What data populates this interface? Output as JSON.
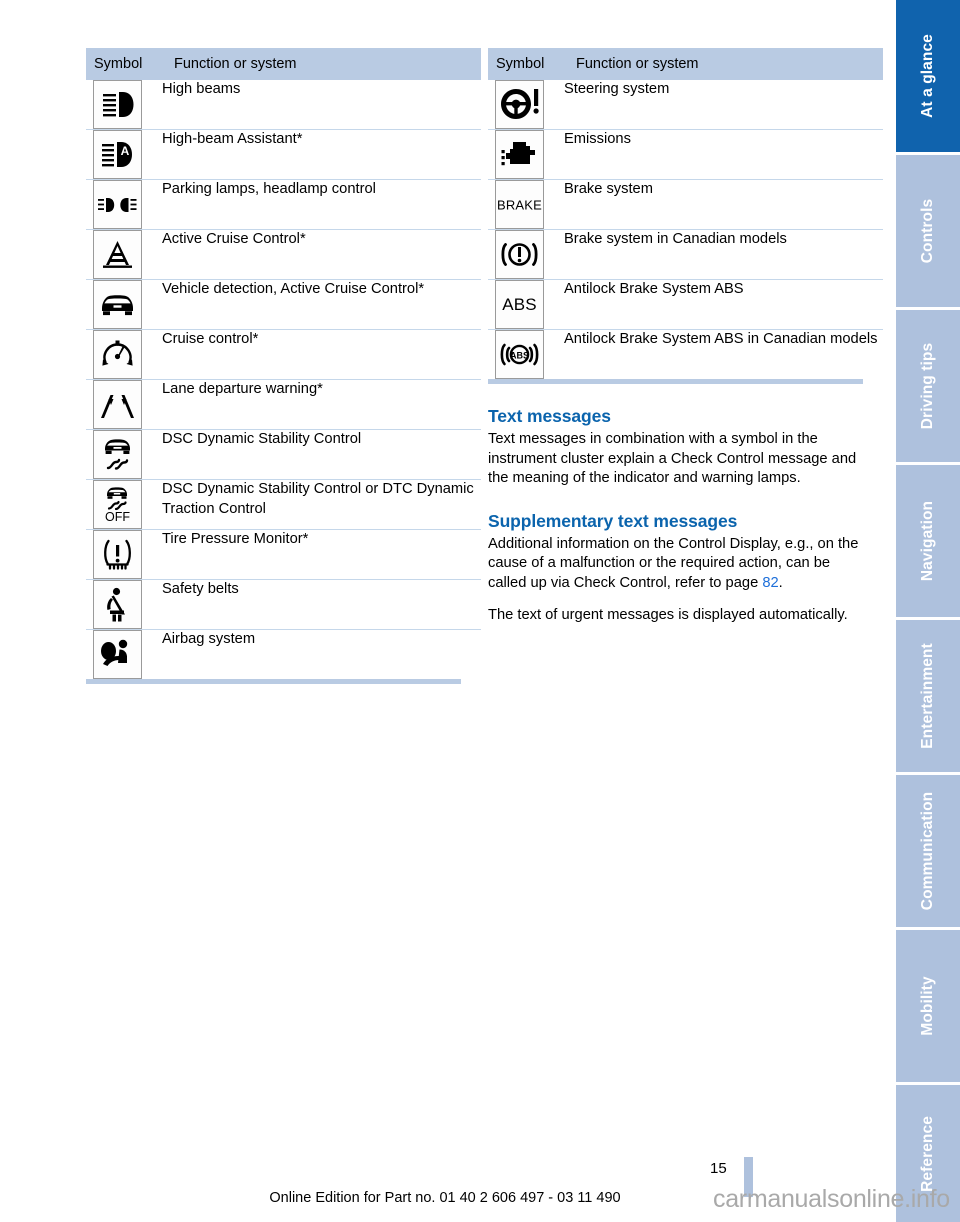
{
  "document": {
    "page_number": "15",
    "footer_note": "Online Edition for Part no. 01 40 2 606 497 - 03 11 490",
    "watermark": "carmanualsonline.info"
  },
  "left_table": {
    "headers": {
      "symbol": "Symbol",
      "function": "Function or system"
    },
    "rows": [
      {
        "icon": "high-beams-icon",
        "label": "High beams"
      },
      {
        "icon": "high-beam-assistant-icon",
        "label": "High-beam Assistant*"
      },
      {
        "icon": "parking-lamps-icon",
        "label": "Parking lamps, headlamp control"
      },
      {
        "icon": "active-cruise-control-icon",
        "label": "Active Cruise Control*"
      },
      {
        "icon": "vehicle-detection-icon",
        "label": "Vehicle detection, Active Cruise Control*"
      },
      {
        "icon": "cruise-control-icon",
        "label": "Cruise control*"
      },
      {
        "icon": "lane-departure-warning-icon",
        "label": "Lane departure warning*"
      },
      {
        "icon": "dsc-icon",
        "label": "DSC Dynamic Stability Control"
      },
      {
        "icon": "dsc-off-icon",
        "label": "DSC Dynamic Stability Control or DTC Dynamic Traction Control"
      },
      {
        "icon": "tire-pressure-monitor-icon",
        "label": "Tire Pressure Monitor*"
      },
      {
        "icon": "safety-belts-icon",
        "label": "Safety belts"
      },
      {
        "icon": "airbag-system-icon",
        "label": "Airbag system"
      }
    ]
  },
  "right_table": {
    "headers": {
      "symbol": "Symbol",
      "function": "Function or system"
    },
    "rows": [
      {
        "icon": "steering-system-icon",
        "label": "Steering system"
      },
      {
        "icon": "emissions-icon",
        "label": "Emissions"
      },
      {
        "icon": "brake-system-icon",
        "glyph": "BRAKE",
        "label": "Brake system"
      },
      {
        "icon": "brake-system-canadian-icon",
        "label": "Brake system in Canadian models"
      },
      {
        "icon": "abs-icon",
        "glyph": "ABS",
        "label": "Antilock Brake System ABS"
      },
      {
        "icon": "abs-canadian-icon",
        "label": "Antilock Brake System ABS in Canadian models"
      }
    ]
  },
  "sections": [
    {
      "heading": "Text messages",
      "paragraphs": [
        "Text messages in combination with a symbol in the instrument cluster explain a Check Control message and the meaning of the indicator and warning lamps."
      ]
    },
    {
      "heading": "Supplementary text messages",
      "paragraphs": [
        "Additional information on the Control Display, e.g., on the cause of a malfunction or the required action, can be called up via Check Control, refer to page ",
        "The text of urgent messages is displayed automatically."
      ],
      "page_reference": "82"
    }
  ],
  "rail": {
    "tabs": [
      {
        "label": "At a glance",
        "active": true
      },
      {
        "label": "Controls",
        "active": false
      },
      {
        "label": "Driving tips",
        "active": false
      },
      {
        "label": "Navigation",
        "active": false
      },
      {
        "label": "Entertainment",
        "active": false
      },
      {
        "label": "Communication",
        "active": false
      },
      {
        "label": "Mobility",
        "active": false
      },
      {
        "label": "Reference",
        "active": false
      }
    ]
  },
  "colors": {
    "header_band": "#b9cbe3",
    "rail_inactive": "#aec1dd",
    "rail_active": "#1063ad",
    "heading_blue": "#0b64ad",
    "link_blue": "#1e6fd9"
  }
}
